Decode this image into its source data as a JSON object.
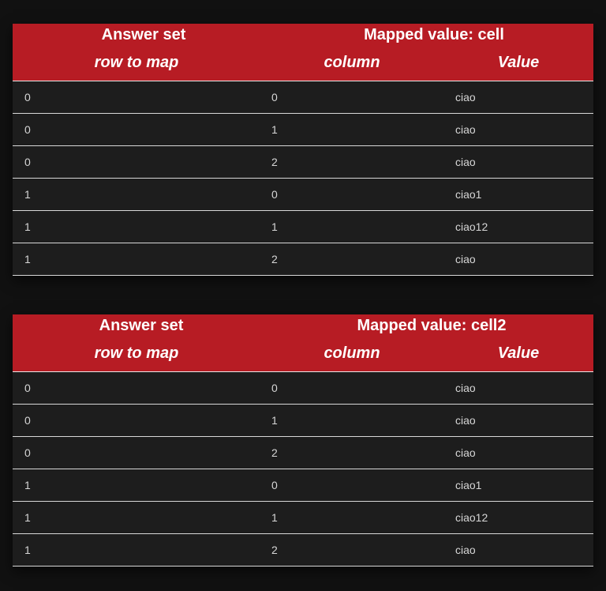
{
  "tables": [
    {
      "answer_set_label": "Answer set",
      "mapped_value_label": "Mapped value: cell",
      "columns": {
        "row": "row to map",
        "column": "column",
        "value": "Value"
      },
      "rows": [
        {
          "row": "0",
          "column": "0",
          "value": "ciao"
        },
        {
          "row": "0",
          "column": "1",
          "value": "ciao"
        },
        {
          "row": "0",
          "column": "2",
          "value": "ciao"
        },
        {
          "row": "1",
          "column": "0",
          "value": "ciao1"
        },
        {
          "row": "1",
          "column": "1",
          "value": "ciao12"
        },
        {
          "row": "1",
          "column": "2",
          "value": "ciao"
        }
      ]
    },
    {
      "answer_set_label": "Answer set",
      "mapped_value_label": "Mapped value: cell2",
      "columns": {
        "row": "row to map",
        "column": "column",
        "value": "Value"
      },
      "rows": [
        {
          "row": "0",
          "column": "0",
          "value": "ciao"
        },
        {
          "row": "0",
          "column": "1",
          "value": "ciao"
        },
        {
          "row": "0",
          "column": "2",
          "value": "ciao"
        },
        {
          "row": "1",
          "column": "0",
          "value": "ciao1"
        },
        {
          "row": "1",
          "column": "1",
          "value": "ciao12"
        },
        {
          "row": "1",
          "column": "2",
          "value": "ciao"
        }
      ]
    }
  ],
  "colors": {
    "header_bg": "#b71c24",
    "page_bg": "#111111"
  }
}
